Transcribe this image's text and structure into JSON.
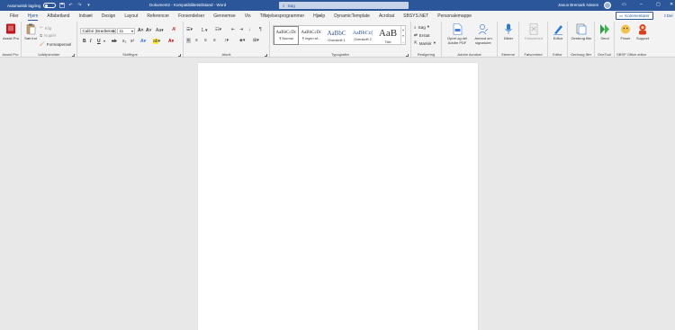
{
  "titlebar": {
    "autosave_label": "Automatisk lagring",
    "doc_title": "Dokument2 - Kompatibilitetstilstand - Word",
    "search_placeholder": "Søg",
    "user_name": "Janus Bremark Nissen"
  },
  "menu": {
    "tabs": [
      "Filer",
      "Hjem",
      "Alfabetland",
      "Indsæt",
      "Design",
      "Layout",
      "Referencer",
      "Forsendelser",
      "Gennemse",
      "Vis",
      "Tilføjelsesprogrammer",
      "Hjælp",
      "DynamicTemplate",
      "Acrobat",
      "SBSYS.NET",
      "Personalemappe"
    ],
    "active_tab": "Hjem",
    "comments_label": "Kommentarer",
    "share_label": "Del"
  },
  "ribbon": {
    "assist": {
      "label": "Assist Pro",
      "group": "Assist Pro"
    },
    "clipboard": {
      "paste_label": "Sæt ind",
      "cut_label": "Klip",
      "copy_label": "Kopiér",
      "format_painter_label": "Formatpensel",
      "group": "Udklipsholder"
    },
    "font": {
      "font_name": "Calibri (Brødtekst)",
      "font_size": "11",
      "group": "Skrifttype"
    },
    "paragraph": {
      "group": "Afsnit"
    },
    "styles": {
      "tiles": [
        {
          "preview": "AaBbCcDc",
          "name": "¶ Normal"
        },
        {
          "preview": "AaBbCcDc",
          "name": "¶ Ingen af..."
        },
        {
          "preview": "AaBbC",
          "name": "Overskrift 1"
        },
        {
          "preview": "AaBbCc(",
          "name": "Overskrift 2"
        },
        {
          "preview": "AaB",
          "name": "Titel"
        }
      ],
      "group": "Typografier"
    },
    "editing": {
      "find_label": "Søg",
      "replace_label": "Erstat",
      "select_label": "Markér",
      "group": "Redigering"
    },
    "acrobat": {
      "create_pdf_label": "Opret og del Adobe PDF",
      "sign_label": "Anmod om signaturer",
      "group": "Adobe Acrobat"
    },
    "voice": {
      "dictate_label": "Dikter",
      "group": "Stemme"
    },
    "sensitivity": {
      "label": "Følsomhed",
      "group": "Følsomhed"
    },
    "editor": {
      "label": "Editor",
      "group": "Editor"
    },
    "reuse": {
      "label": "Genbrug filer",
      "group": "Genbrug filer"
    },
    "onetool": {
      "label": "Send",
      "group": "OneTool"
    },
    "sbsp": {
      "fix_label": "Fixser",
      "support_label": "Support",
      "group": "SBSP Office editor"
    }
  }
}
